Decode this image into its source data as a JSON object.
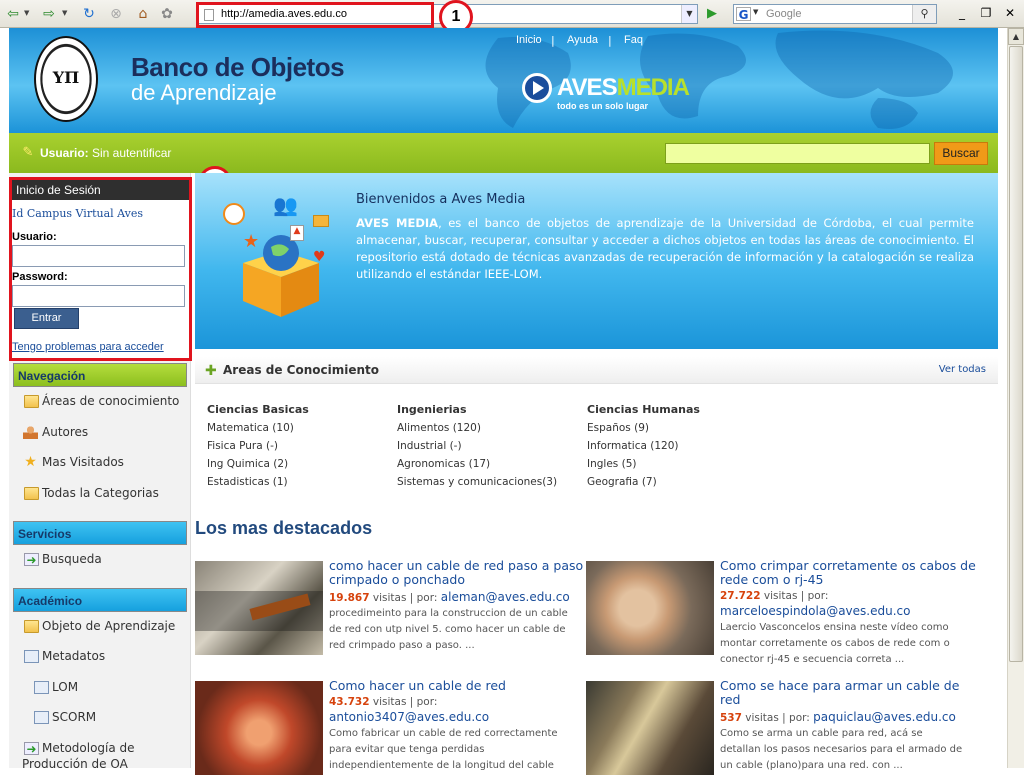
{
  "browser": {
    "url": "http://amedia.aves.edu.co",
    "search_placeholder": "Google",
    "search_engine_glyph": "G",
    "markers": [
      "1",
      "2"
    ]
  },
  "header": {
    "title": "Banco de Objetos",
    "subtitle": "de Aprendizaje",
    "seal_letters": "ΥΠ",
    "links": [
      "Inicio",
      "Ayuda",
      "Faq"
    ],
    "brand": {
      "part1": "AVES",
      "part2": "MEDIA",
      "tagline": "todo es un solo lugar"
    }
  },
  "userbar": {
    "label": "Usuario:",
    "status": "Sin autentificar",
    "search_button": "Buscar"
  },
  "login": {
    "heading": "Inicio de Sesión",
    "campus_link": "Id Campus Virtual Aves",
    "user_label": "Usuario:",
    "password_label": "Password:",
    "submit": "Entrar",
    "trouble_link": "Tengo problemas para acceder"
  },
  "nav": {
    "navegacion": {
      "heading": "Navegación",
      "items": [
        "Áreas de conocimiento",
        "Autores",
        "Mas Visitados",
        "Todas la Categorias"
      ]
    },
    "servicios": {
      "heading": "Servicios",
      "items": [
        "Busqueda"
      ]
    },
    "academico": {
      "heading": "Académico",
      "items": [
        "Objeto de Aprendizaje",
        "Metadatos",
        "LOM",
        "SCORM",
        "Metodología de",
        "Producción de OA"
      ]
    }
  },
  "welcome": {
    "title": "Bienvenidos a Aves Media",
    "brand_bold": "AVES MEDIA",
    "text": ", es el banco de objetos de aprendizaje de la Universidad de Córdoba, el cual permite almacenar, buscar, recuperar, consultar y acceder a dichos objetos en todas las áreas de conocimiento. El repositorio está dotado de técnicas avanzadas de recuperación de información y la catalogación se realiza utilizando el estándar IEEE-LOM."
  },
  "areas": {
    "title": "Areas de Conocimiento",
    "see_all": "Ver todas",
    "columns": [
      {
        "heading": "Ciencias Basicas",
        "items": [
          "Matematica (10)",
          "Fisica Pura (-)",
          "Ing Quimica (2)",
          "Estadisticas (1)"
        ]
      },
      {
        "heading": "Ingenierias",
        "items": [
          "Alimentos (120)",
          "Industrial (-)",
          "Agronomicas (17)",
          "Sistemas y comunicaciones(3)"
        ]
      },
      {
        "heading": "Ciencias Humanas",
        "items": [
          "Españos (9)",
          "Informatica (120)",
          "Ingles (5)",
          "Geografia (7)"
        ]
      }
    ]
  },
  "featured": {
    "title": "Los mas destacados",
    "visits_word": "visitas",
    "by_word": "por:",
    "items": [
      {
        "title": "como hacer un cable de red paso a paso crimpado o ponchado",
        "visits": "19.867",
        "author": "aleman@aves.edu.co",
        "desc": "procedimeinto para la construccion de un cable de red con utp nivel 5. como hacer un cable de red crimpado paso a paso. ..."
      },
      {
        "title": "Como crimpar corretamente os cabos de rede com o rj-45",
        "visits": "27.722",
        "author": "marceloespindola@aves.edu.co",
        "desc": "Laercio Vasconcelos ensina neste vídeo como montar corretamente os cabos de rede com o conector rj-45 e secuencia correta ..."
      },
      {
        "title": "Como hacer un cable de red",
        "visits": "43.732",
        "author": "antonio3407@aves.edu.co",
        "desc": "Como fabricar un cable de red correctamente para evitar que tenga perdidas independientemente de la longitud del cable"
      },
      {
        "title": "Como se hace para armar un cable de red",
        "visits": "537",
        "author": "paquiclau@aves.edu.co",
        "desc": "Como se arma un cable para red, acá se detallan los pasos necesarios para el armado de un cable (plano)para una red. con ..."
      }
    ]
  },
  "colors": {
    "accent_green": "#9cc626",
    "header_blue": "#1d90d6",
    "button_orange": "#f09a18",
    "link_blue": "#1a4d9a",
    "highlight_red": "#e0141e"
  }
}
